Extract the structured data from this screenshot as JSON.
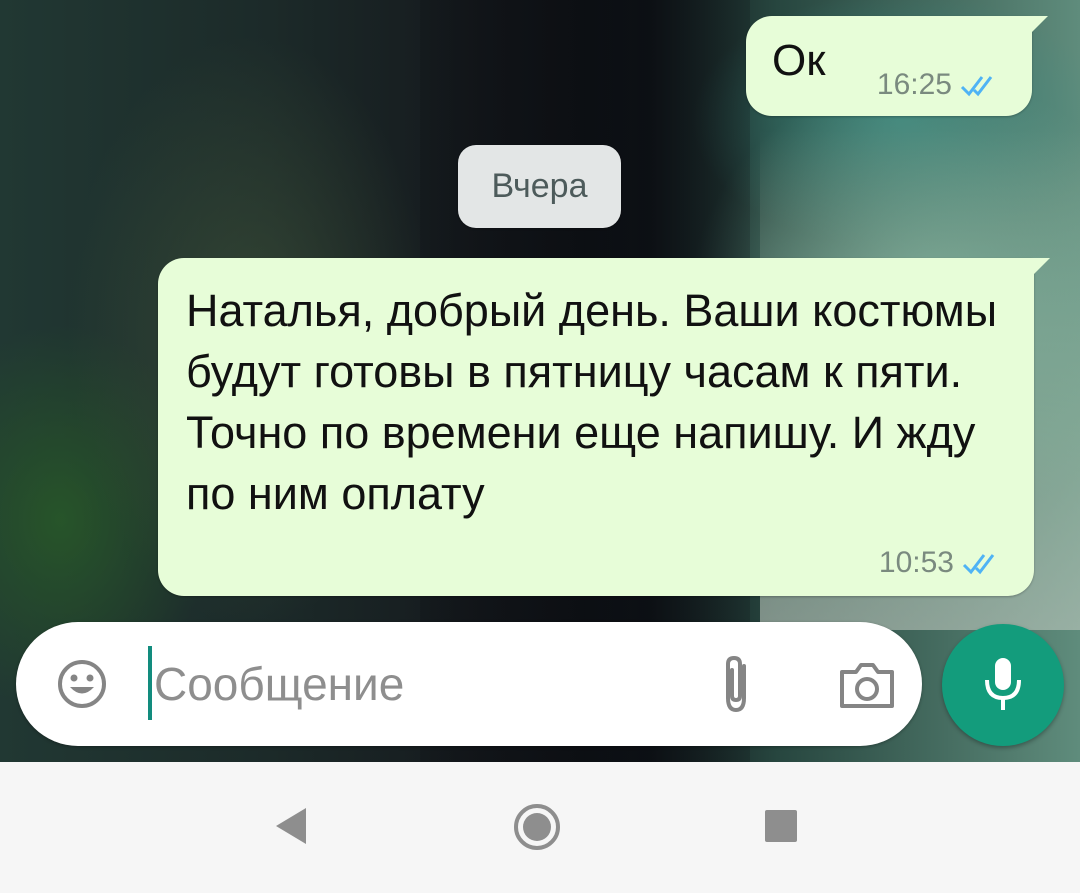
{
  "colors": {
    "outgoing_bubble": "#e7fdd8",
    "accent": "#128c7e",
    "mic_button": "#139c7c",
    "read_ticks": "#4fb3f5",
    "date_chip": "#e3e6e6"
  },
  "chat": {
    "messages": [
      {
        "direction": "outgoing",
        "text": "Ок",
        "time": "16:25",
        "status": "read"
      },
      {
        "direction": "outgoing",
        "text": "Наталья, добрый день. Ваши костюмы будут готовы в пятницу часам к пяти. Точно по времени еще напишу. И жду по ним оплату",
        "time": "10:53",
        "status": "read"
      }
    ],
    "date_separator": "Вчера"
  },
  "composer": {
    "placeholder": "Сообщение",
    "value": "",
    "icons": [
      "emoji-icon",
      "paperclip-icon",
      "camera-icon",
      "mic-icon"
    ]
  },
  "navbar": {
    "icons": [
      "back-icon",
      "home-icon",
      "recents-icon"
    ]
  }
}
